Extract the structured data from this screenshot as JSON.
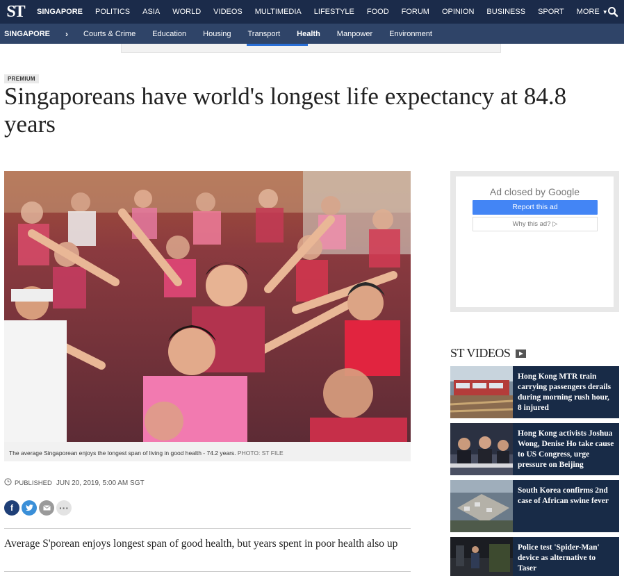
{
  "topnav": {
    "logo": "ST",
    "items": [
      "SINGAPORE",
      "POLITICS",
      "ASIA",
      "WORLD",
      "VIDEOS",
      "MULTIMEDIA",
      "LIFESTYLE",
      "FOOD",
      "FORUM",
      "OPINION",
      "BUSINESS",
      "SPORT",
      "MORE"
    ],
    "active": "SINGAPORE",
    "search_icon": "search-icon"
  },
  "subnav": {
    "section": "SINGAPORE",
    "items": [
      "Courts & Crime",
      "Education",
      "Housing",
      "Transport",
      "Health",
      "Manpower",
      "Environment"
    ],
    "active": "Health"
  },
  "article": {
    "badge": "PREMIUM",
    "headline": "Singaporeans have world's longest life expectancy at 84.8 years",
    "caption": "The average Singaporean enjoys the longest span of living in good health - 74.2 years.",
    "photo_credit": "PHOTO: ST FILE",
    "published_label": "PUBLISHED",
    "published_date": "JUN 20, 2019, 5:00 AM SGT",
    "standfirst": "Average S'porean enjoys longest span of good health, but years spent in poor health also up",
    "share": [
      "facebook-icon",
      "twitter-icon",
      "email-icon",
      "more-icon"
    ]
  },
  "ad": {
    "closed_text": "Ad closed by Google",
    "report": "Report this ad",
    "why": "Why this ad? ▷"
  },
  "videos": {
    "title": "ST VIDEOS",
    "items": [
      {
        "title": "Hong Kong MTR train carrying passengers derails during morning rush hour, 8 injured"
      },
      {
        "title": "Hong Kong activists Joshua Wong, Denise Ho take cause to US Congress, urge pressure on Beijing"
      },
      {
        "title": "South Korea confirms 2nd case of African swine fever"
      },
      {
        "title": "Police test 'Spider-Man' device as alternative to Taser"
      }
    ]
  },
  "colors": {
    "topnav_bg": "#1b2b4a",
    "subnav_bg": "#2f4468",
    "video_card_bg": "#182b47",
    "report_button": "#4385f5",
    "facebook": "#1f3f77",
    "twitter": "#3a8fd8"
  }
}
